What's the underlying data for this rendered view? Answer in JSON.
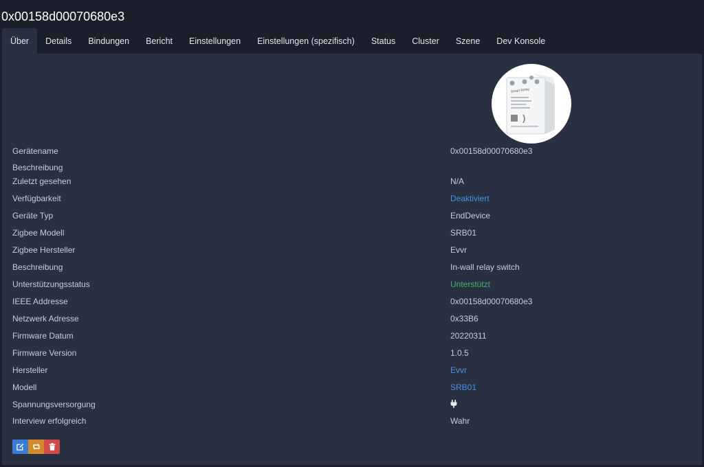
{
  "page": {
    "title": "0x00158d00070680e3"
  },
  "tabs": [
    {
      "label": "Über"
    },
    {
      "label": "Details"
    },
    {
      "label": "Bindungen"
    },
    {
      "label": "Bericht"
    },
    {
      "label": "Einstellungen"
    },
    {
      "label": "Einstellungen (spezifisch)"
    },
    {
      "label": "Status"
    },
    {
      "label": "Cluster"
    },
    {
      "label": "Szene"
    },
    {
      "label": "Dev Konsole"
    }
  ],
  "device_image": {
    "icon": "smart-relay-image",
    "text": "Smart Relay"
  },
  "info": {
    "geraetename": {
      "label": "Gerätename",
      "value": "0x00158d00070680e3"
    },
    "beschreibung_top": {
      "label": "Beschreibung",
      "value": ""
    },
    "zuletzt": {
      "label": "Zuletzt gesehen",
      "value": "N/A"
    },
    "verfuegbarkeit": {
      "label": "Verfügbarkeit",
      "value": "Deaktiviert"
    },
    "geraetetyp": {
      "label": "Geräte Typ",
      "value": "EndDevice"
    },
    "zigbee_modell": {
      "label": "Zigbee Modell",
      "value": "SRB01"
    },
    "zigbee_hersteller": {
      "label": "Zigbee Hersteller",
      "value": "Evvr"
    },
    "beschreibung": {
      "label": "Beschreibung",
      "value": "In-wall relay switch"
    },
    "unterstuetzung": {
      "label": "Unterstützungsstatus",
      "value": "Unterstützt"
    },
    "ieee": {
      "label": "IEEE Addresse",
      "value": "0x00158d00070680e3"
    },
    "netzwerk": {
      "label": "Netzwerk Adresse",
      "value": "0x33B6"
    },
    "fw_datum": {
      "label": "Firmware Datum",
      "value": "20220311"
    },
    "fw_version": {
      "label": "Firmware Version",
      "value": "1.0.5"
    },
    "hersteller": {
      "label": "Hersteller",
      "value": "Evvr"
    },
    "modell": {
      "label": "Modell",
      "value": "SRB01"
    },
    "spannung": {
      "label": "Spannungsversorgung",
      "icon": "power-plug-icon"
    },
    "interview": {
      "label": "Interview erfolgreich",
      "value": "Wahr"
    }
  },
  "actions": {
    "edit": {
      "icon": "edit-icon"
    },
    "rename": {
      "icon": "reconfigure-icon"
    },
    "delete": {
      "icon": "trash-icon"
    }
  },
  "colors": {
    "background": "#1b1f2b",
    "panel": "#283041",
    "link": "#4c8fe8",
    "success": "#4caf6a",
    "edit": "#3a7bd5",
    "rename": "#d38a2a",
    "delete": "#d24b4b"
  }
}
